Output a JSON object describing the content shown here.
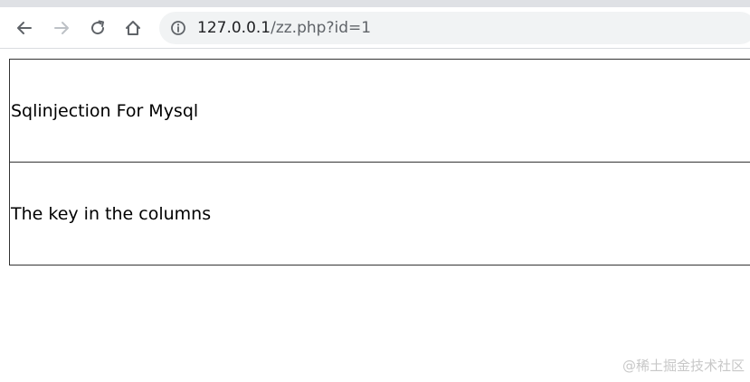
{
  "browser": {
    "back_icon": "arrow-left-icon",
    "forward_icon": "arrow-right-icon",
    "reload_icon": "reload-icon",
    "home_icon": "home-icon",
    "site_info_icon": "info-icon",
    "url_host": "127.0.0.1",
    "url_path": "/zz.php?id=1"
  },
  "page": {
    "rows": [
      {
        "text": "Sqlinjection For Mysql"
      },
      {
        "text": "The key in the columns"
      }
    ]
  },
  "watermark": "@稀土掘金技术社区"
}
